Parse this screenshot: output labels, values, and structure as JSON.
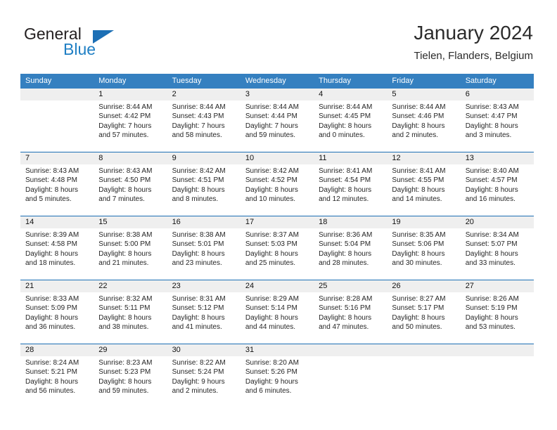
{
  "brand": {
    "name_part1": "General",
    "name_part2": "Blue",
    "logo_icon": "triangle-logo-icon"
  },
  "header": {
    "title": "January 2024",
    "subtitle": "Tielen, Flanders, Belgium"
  },
  "colors": {
    "header_blue": "#3580c0",
    "separator_blue": "#1c6fb5",
    "daynum_band": "#efefef",
    "brand_blue": "#1f7fc4"
  },
  "weekdays": [
    "Sunday",
    "Monday",
    "Tuesday",
    "Wednesday",
    "Thursday",
    "Friday",
    "Saturday"
  ],
  "weeks": [
    [
      {
        "day": "",
        "lines": [
          "",
          "",
          "",
          ""
        ]
      },
      {
        "day": "1",
        "lines": [
          "Sunrise: 8:44 AM",
          "Sunset: 4:42 PM",
          "Daylight: 7 hours",
          "and 57 minutes."
        ]
      },
      {
        "day": "2",
        "lines": [
          "Sunrise: 8:44 AM",
          "Sunset: 4:43 PM",
          "Daylight: 7 hours",
          "and 58 minutes."
        ]
      },
      {
        "day": "3",
        "lines": [
          "Sunrise: 8:44 AM",
          "Sunset: 4:44 PM",
          "Daylight: 7 hours",
          "and 59 minutes."
        ]
      },
      {
        "day": "4",
        "lines": [
          "Sunrise: 8:44 AM",
          "Sunset: 4:45 PM",
          "Daylight: 8 hours",
          "and 0 minutes."
        ]
      },
      {
        "day": "5",
        "lines": [
          "Sunrise: 8:44 AM",
          "Sunset: 4:46 PM",
          "Daylight: 8 hours",
          "and 2 minutes."
        ]
      },
      {
        "day": "6",
        "lines": [
          "Sunrise: 8:43 AM",
          "Sunset: 4:47 PM",
          "Daylight: 8 hours",
          "and 3 minutes."
        ]
      }
    ],
    [
      {
        "day": "7",
        "lines": [
          "Sunrise: 8:43 AM",
          "Sunset: 4:48 PM",
          "Daylight: 8 hours",
          "and 5 minutes."
        ]
      },
      {
        "day": "8",
        "lines": [
          "Sunrise: 8:43 AM",
          "Sunset: 4:50 PM",
          "Daylight: 8 hours",
          "and 7 minutes."
        ]
      },
      {
        "day": "9",
        "lines": [
          "Sunrise: 8:42 AM",
          "Sunset: 4:51 PM",
          "Daylight: 8 hours",
          "and 8 minutes."
        ]
      },
      {
        "day": "10",
        "lines": [
          "Sunrise: 8:42 AM",
          "Sunset: 4:52 PM",
          "Daylight: 8 hours",
          "and 10 minutes."
        ]
      },
      {
        "day": "11",
        "lines": [
          "Sunrise: 8:41 AM",
          "Sunset: 4:54 PM",
          "Daylight: 8 hours",
          "and 12 minutes."
        ]
      },
      {
        "day": "12",
        "lines": [
          "Sunrise: 8:41 AM",
          "Sunset: 4:55 PM",
          "Daylight: 8 hours",
          "and 14 minutes."
        ]
      },
      {
        "day": "13",
        "lines": [
          "Sunrise: 8:40 AM",
          "Sunset: 4:57 PM",
          "Daylight: 8 hours",
          "and 16 minutes."
        ]
      }
    ],
    [
      {
        "day": "14",
        "lines": [
          "Sunrise: 8:39 AM",
          "Sunset: 4:58 PM",
          "Daylight: 8 hours",
          "and 18 minutes."
        ]
      },
      {
        "day": "15",
        "lines": [
          "Sunrise: 8:38 AM",
          "Sunset: 5:00 PM",
          "Daylight: 8 hours",
          "and 21 minutes."
        ]
      },
      {
        "day": "16",
        "lines": [
          "Sunrise: 8:38 AM",
          "Sunset: 5:01 PM",
          "Daylight: 8 hours",
          "and 23 minutes."
        ]
      },
      {
        "day": "17",
        "lines": [
          "Sunrise: 8:37 AM",
          "Sunset: 5:03 PM",
          "Daylight: 8 hours",
          "and 25 minutes."
        ]
      },
      {
        "day": "18",
        "lines": [
          "Sunrise: 8:36 AM",
          "Sunset: 5:04 PM",
          "Daylight: 8 hours",
          "and 28 minutes."
        ]
      },
      {
        "day": "19",
        "lines": [
          "Sunrise: 8:35 AM",
          "Sunset: 5:06 PM",
          "Daylight: 8 hours",
          "and 30 minutes."
        ]
      },
      {
        "day": "20",
        "lines": [
          "Sunrise: 8:34 AM",
          "Sunset: 5:07 PM",
          "Daylight: 8 hours",
          "and 33 minutes."
        ]
      }
    ],
    [
      {
        "day": "21",
        "lines": [
          "Sunrise: 8:33 AM",
          "Sunset: 5:09 PM",
          "Daylight: 8 hours",
          "and 36 minutes."
        ]
      },
      {
        "day": "22",
        "lines": [
          "Sunrise: 8:32 AM",
          "Sunset: 5:11 PM",
          "Daylight: 8 hours",
          "and 38 minutes."
        ]
      },
      {
        "day": "23",
        "lines": [
          "Sunrise: 8:31 AM",
          "Sunset: 5:12 PM",
          "Daylight: 8 hours",
          "and 41 minutes."
        ]
      },
      {
        "day": "24",
        "lines": [
          "Sunrise: 8:29 AM",
          "Sunset: 5:14 PM",
          "Daylight: 8 hours",
          "and 44 minutes."
        ]
      },
      {
        "day": "25",
        "lines": [
          "Sunrise: 8:28 AM",
          "Sunset: 5:16 PM",
          "Daylight: 8 hours",
          "and 47 minutes."
        ]
      },
      {
        "day": "26",
        "lines": [
          "Sunrise: 8:27 AM",
          "Sunset: 5:17 PM",
          "Daylight: 8 hours",
          "and 50 minutes."
        ]
      },
      {
        "day": "27",
        "lines": [
          "Sunrise: 8:26 AM",
          "Sunset: 5:19 PM",
          "Daylight: 8 hours",
          "and 53 minutes."
        ]
      }
    ],
    [
      {
        "day": "28",
        "lines": [
          "Sunrise: 8:24 AM",
          "Sunset: 5:21 PM",
          "Daylight: 8 hours",
          "and 56 minutes."
        ]
      },
      {
        "day": "29",
        "lines": [
          "Sunrise: 8:23 AM",
          "Sunset: 5:23 PM",
          "Daylight: 8 hours",
          "and 59 minutes."
        ]
      },
      {
        "day": "30",
        "lines": [
          "Sunrise: 8:22 AM",
          "Sunset: 5:24 PM",
          "Daylight: 9 hours",
          "and 2 minutes."
        ]
      },
      {
        "day": "31",
        "lines": [
          "Sunrise: 8:20 AM",
          "Sunset: 5:26 PM",
          "Daylight: 9 hours",
          "and 6 minutes."
        ]
      },
      {
        "day": "",
        "lines": [
          "",
          "",
          "",
          ""
        ]
      },
      {
        "day": "",
        "lines": [
          "",
          "",
          "",
          ""
        ]
      },
      {
        "day": "",
        "lines": [
          "",
          "",
          "",
          ""
        ]
      }
    ]
  ]
}
